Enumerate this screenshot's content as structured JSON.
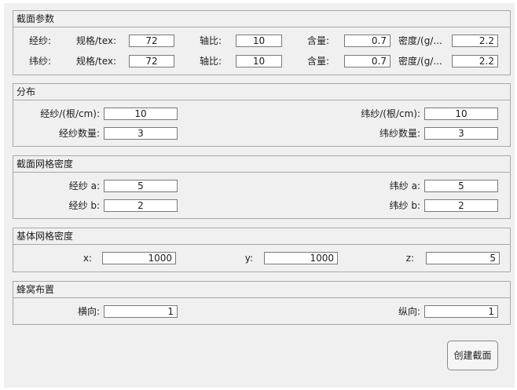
{
  "section": {
    "title": "截面参数",
    "warp": {
      "label": "经纱:",
      "spec_label": "规格/tex:",
      "spec": "72",
      "ratio_label": "轴比:",
      "ratio": "10",
      "content_label": "含量:",
      "content": "0.7",
      "density_label": "密度/(g/...",
      "density": "2.2"
    },
    "weft": {
      "label": "纬纱:",
      "spec_label": "规格/tex:",
      "spec": "72",
      "ratio_label": "轴比:",
      "ratio": "10",
      "content_label": "含量:",
      "content": "0.7",
      "density_label": "密度/(g/...",
      "density": "2.2"
    }
  },
  "distribution": {
    "title": "分布",
    "warp_density_label": "经纱/(根/cm):",
    "warp_density": "10",
    "weft_density_label": "纬纱/(根/cm):",
    "weft_density": "10",
    "warp_count_label": "经纱数量:",
    "warp_count": "3",
    "weft_count_label": "纬纱数量:",
    "weft_count": "3"
  },
  "mesh": {
    "title": "截面网格密度",
    "warp_a_label": "经纱 a:",
    "warp_a": "5",
    "weft_a_label": "纬纱 a:",
    "weft_a": "5",
    "warp_b_label": "经纱 b:",
    "warp_b": "2",
    "weft_b_label": "纬纱 b:",
    "weft_b": "2"
  },
  "matrix": {
    "title": "基体网格密度",
    "x_label": "x:",
    "x": "1000",
    "y_label": "y:",
    "y": "1000",
    "z_label": "z:",
    "z": "5"
  },
  "honeycomb": {
    "title": "蜂窝布置",
    "horizontal_label": "横向:",
    "horizontal": "1",
    "vertical_label": "纵向:",
    "vertical": "1"
  },
  "create_button": "创建截面"
}
